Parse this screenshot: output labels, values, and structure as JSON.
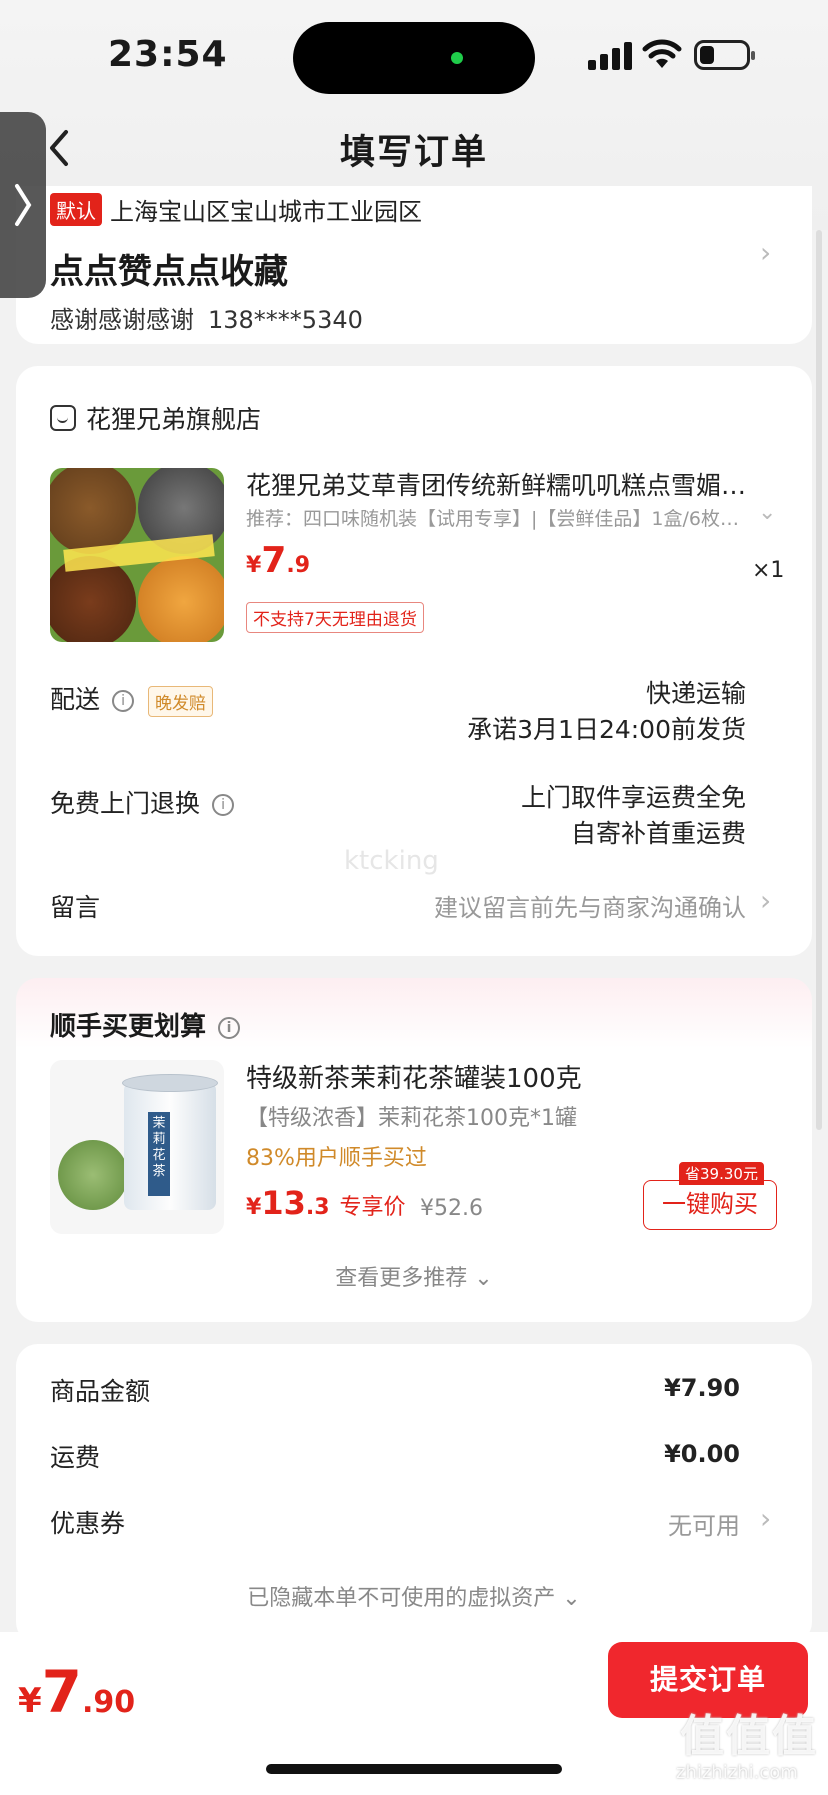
{
  "status_bar": {
    "time": "23:54"
  },
  "nav": {
    "title": "填写订单",
    "back_glyph": "‹"
  },
  "address": {
    "default_tag": "默认",
    "region": "上海宝山区宝山城市工业园区",
    "detail": "点点赞点点收藏",
    "recipient": "感谢感谢感谢",
    "phone": "138****5340"
  },
  "order": {
    "shop_name": "花狸兄弟旗舰店",
    "product": {
      "title": "花狸兄弟艾草青团传统新鲜糯叽叽糕点雪媚…",
      "sku": "推荐：四口味随机装【试用专享】|【尝鲜佳品】1盒/6枚…",
      "price_symbol": "¥",
      "price_int": "7",
      "price_dec": ".9",
      "qty": "×1",
      "no_return_tag": "不支持7天无理由退货"
    },
    "delivery": {
      "label": "配送",
      "late_tag": "晚发赔",
      "method": "快递运输",
      "promise": "承诺3月1日24:00前发货"
    },
    "return": {
      "label": "免费上门退换",
      "line1": "上门取件享运费全免",
      "line2": "自寄补首重运费"
    },
    "message": {
      "label": "留言",
      "placeholder": "建议留言前先与商家沟通确认"
    }
  },
  "recommend": {
    "header": "顺手买更划算",
    "item": {
      "title": "特级新茶茉莉花茶罐装100克",
      "sku": "【特级浓香】茉莉花茶100克*1罐",
      "bought": "83%用户顺手买过",
      "price_symbol": "¥",
      "price_int": "13",
      "price_dec": ".3",
      "price_label": "专享价",
      "orig_price": "¥52.6",
      "save_tag": "省39.30元",
      "buy_label": "一键购买",
      "can_label": "茉莉花茶"
    },
    "more": "查看更多推荐 ⌄"
  },
  "summary": {
    "goods_label": "商品金额",
    "goods_value": "¥7.90",
    "freight_label": "运费",
    "freight_value": "¥0.00",
    "coupon_label": "优惠券",
    "coupon_value": "无可用",
    "hidden_note": "已隐藏本单不可使用的虚拟资产 ⌄"
  },
  "bottom": {
    "total_symbol": "¥",
    "total_int": "7",
    "total_dec": ".90",
    "submit_label": "提交订单"
  },
  "watermarks": {
    "center": "ktcking",
    "corner": "值值值",
    "corner_url": "zhizhizhi.com"
  }
}
